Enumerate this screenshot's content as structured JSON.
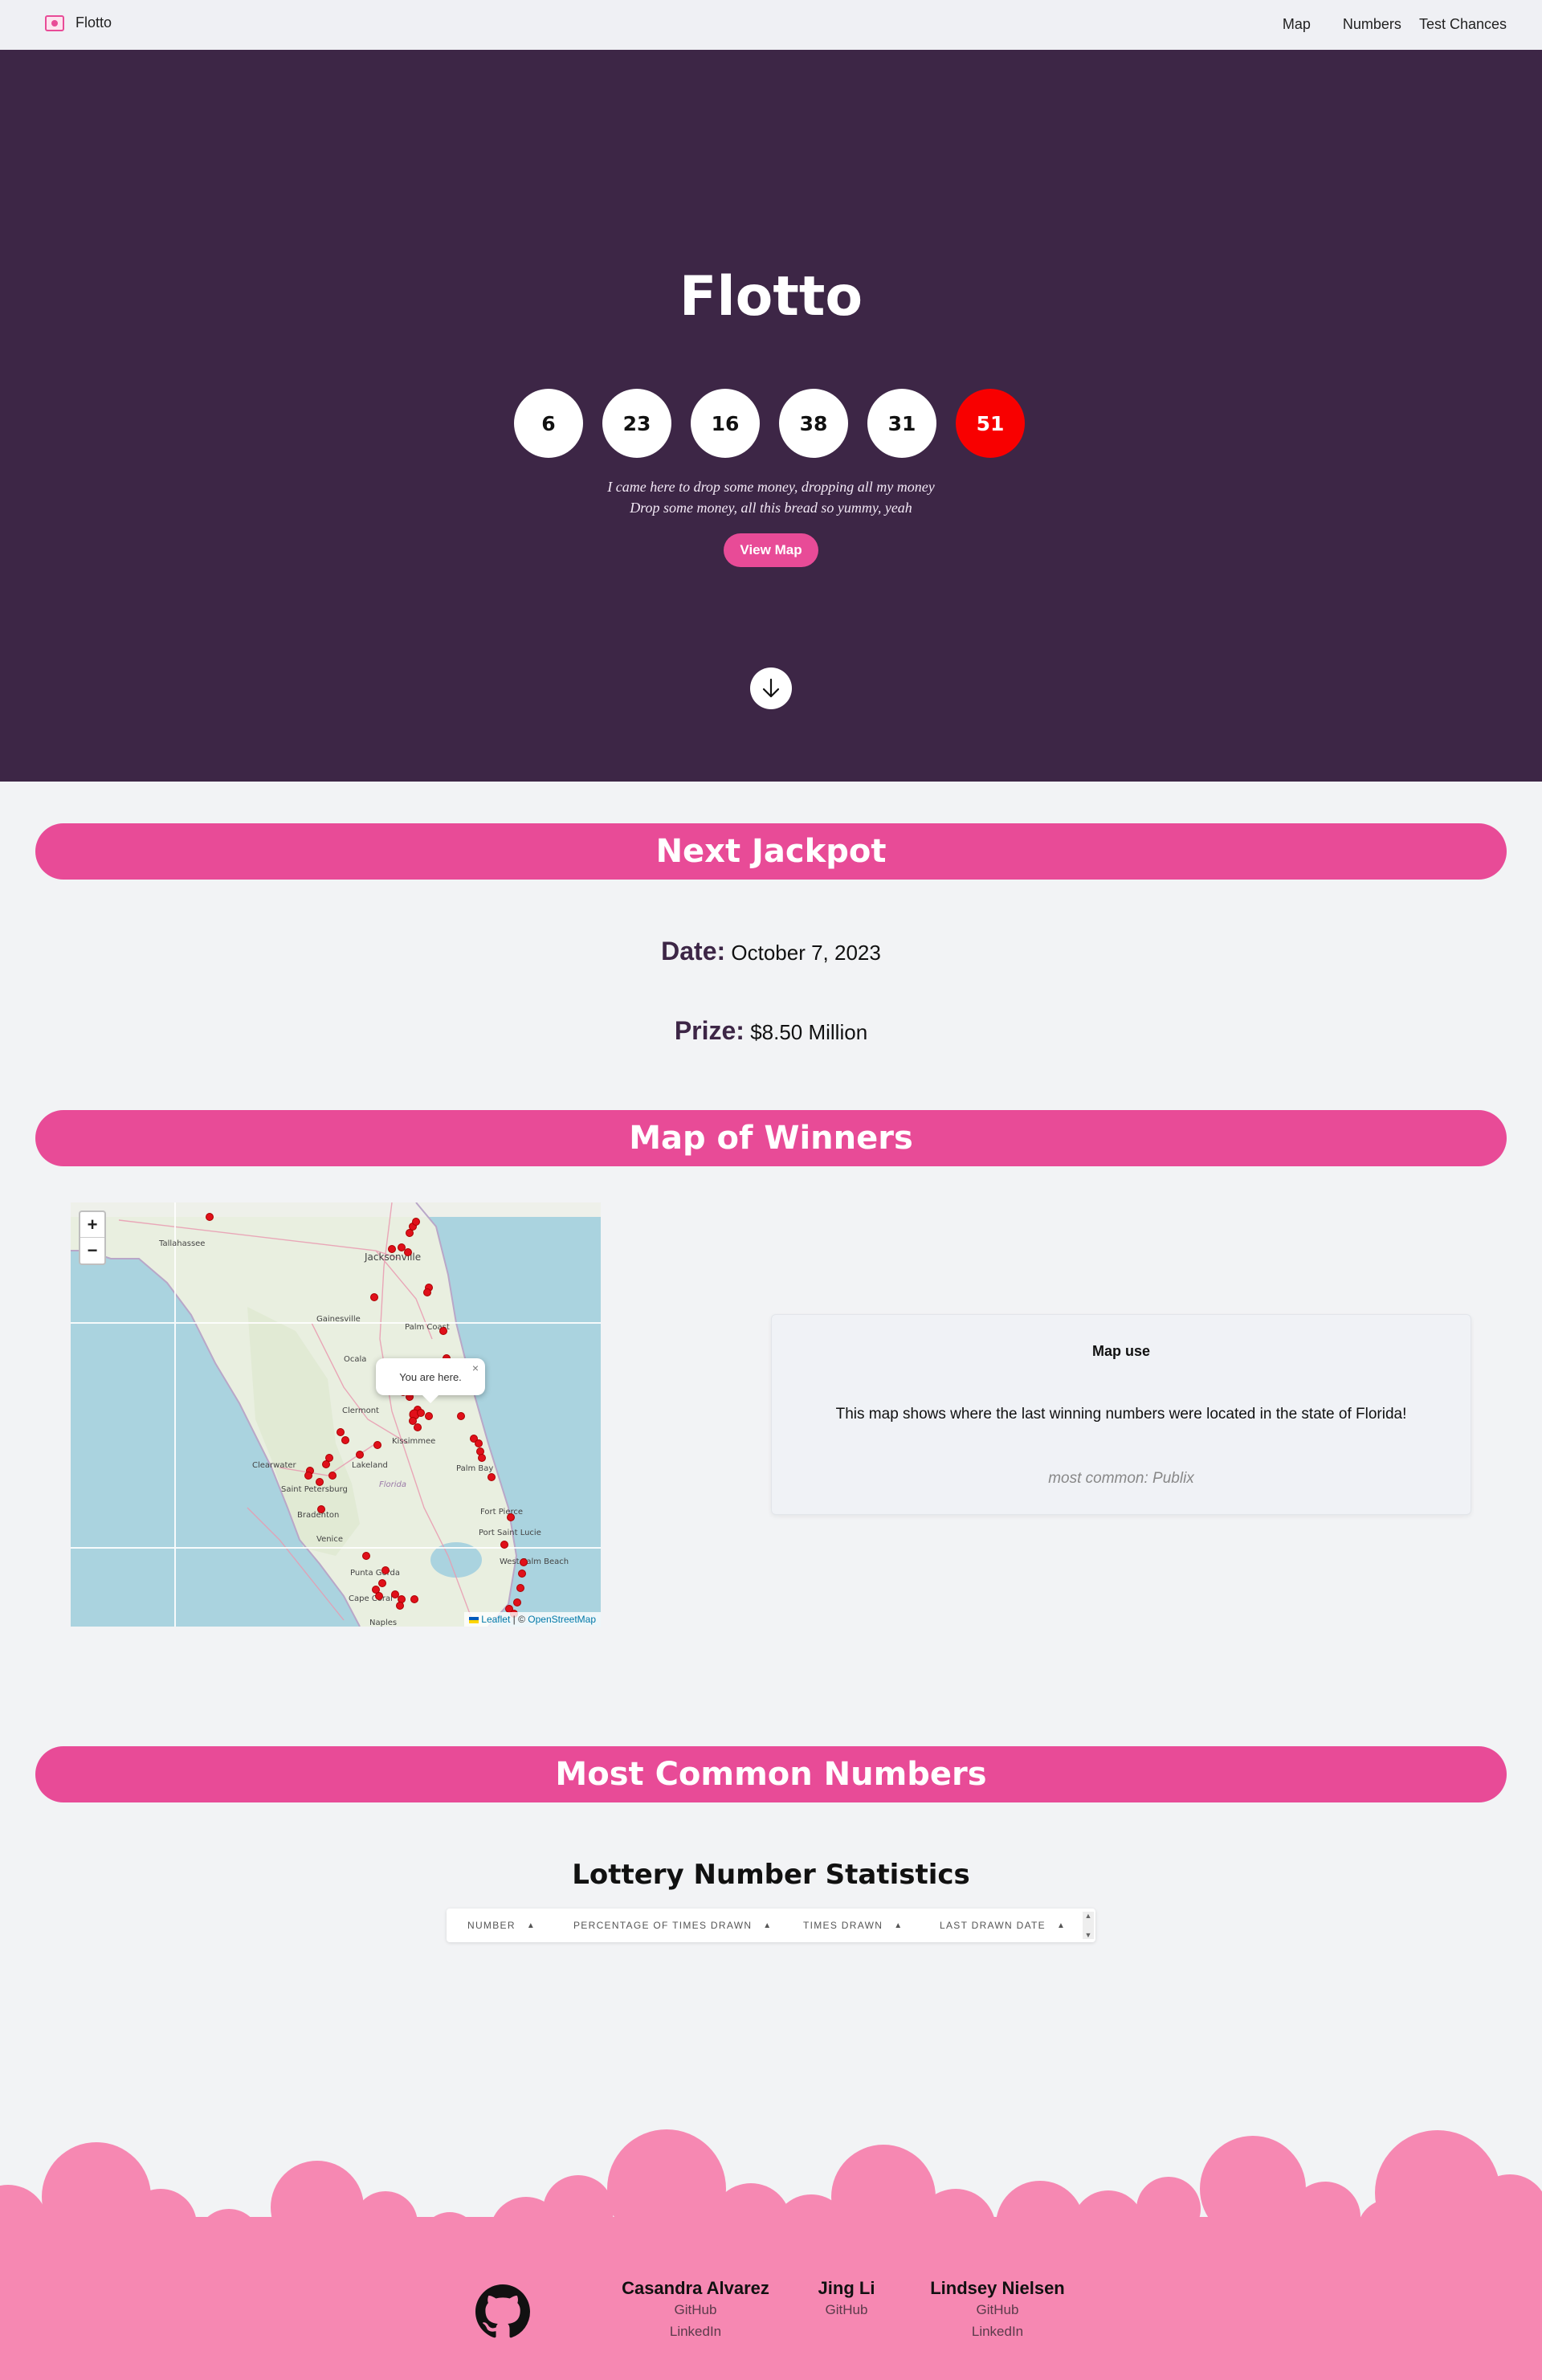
{
  "nav": {
    "brand": "Flotto",
    "links": [
      "Map",
      "Numbers",
      "Test Chances"
    ]
  },
  "hero": {
    "title": "Flotto",
    "balls": [
      "6",
      "23",
      "16",
      "38",
      "31"
    ],
    "powerball": "51",
    "lyric_line1": "I came here to drop some money, dropping all my money",
    "lyric_line2": "Drop some money, all this bread so yummy, yeah",
    "button": "View Map"
  },
  "jackpot": {
    "heading": "Next Jackpot",
    "date_label": "Date:",
    "date_value": "October 7, 2023",
    "prize_label": "Prize:",
    "prize_value": "$8.50 Million"
  },
  "map_section": {
    "heading": "Map of Winners",
    "zoom_in": "+",
    "zoom_out": "−",
    "popup_text": "You are here.",
    "popup_close": "×",
    "attribution_leaflet": "Leaflet",
    "attribution_sep": "| ©",
    "attribution_osm": "OpenStreetMap",
    "places": [
      "Tallahassee",
      "Jacksonville",
      "Gainesville",
      "Palm Coast",
      "Ocala",
      "Clermont",
      "Kissimmee",
      "Lakeland",
      "Clearwater",
      "Saint Petersburg",
      "Bradenton",
      "Venice",
      "Palm Bay",
      "Fort Pierce",
      "Port Saint Lucie",
      "Punta Gorda",
      "Cape Coral",
      "West Palm Beach",
      "Florida",
      "Naples"
    ],
    "card_title": "Map use",
    "card_body": "This map shows where the last winning numbers were located in the state of Florida!",
    "card_footer": "most common: Publix"
  },
  "numbers_section": {
    "heading": "Most Common Numbers",
    "table_title": "Lottery Number Statistics",
    "columns": [
      "NUMBER",
      "PERCENTAGE OF TIMES DRAWN",
      "TIMES DRAWN",
      "LAST DRAWN DATE"
    ]
  },
  "footer": {
    "authors": [
      {
        "name": "Casandra Alvarez",
        "links": [
          "GitHub",
          "LinkedIn"
        ]
      },
      {
        "name": "Jing Li",
        "links": [
          "GitHub"
        ]
      },
      {
        "name": "Lindsey Nielsen",
        "links": [
          "GitHub",
          "LinkedIn"
        ]
      }
    ]
  },
  "colors": {
    "hero_bg": "#3d2646",
    "accent_pink": "#e84b97",
    "powerball_red": "#f80000",
    "footer_pink": "#f688b2"
  }
}
